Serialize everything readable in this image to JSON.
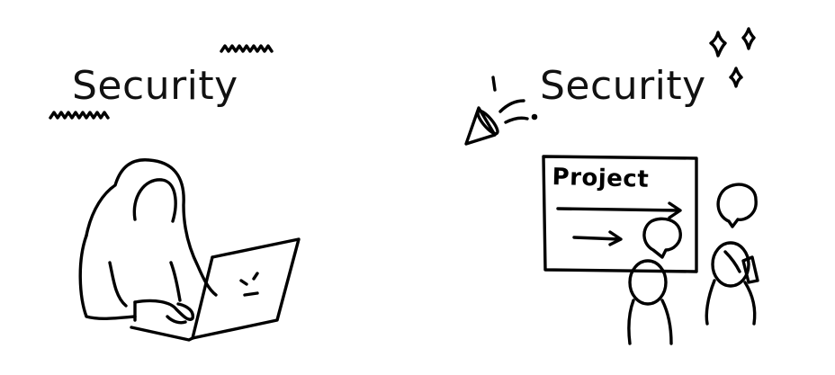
{
  "panels": [
    {
      "heading": "Security",
      "illustration": "hooded-hacker-at-laptop"
    },
    {
      "heading": "Security",
      "illustration": "team-at-project-board",
      "board_title": "Project"
    }
  ],
  "colors": {
    "ink": "#000000",
    "background": "#ffffff"
  }
}
